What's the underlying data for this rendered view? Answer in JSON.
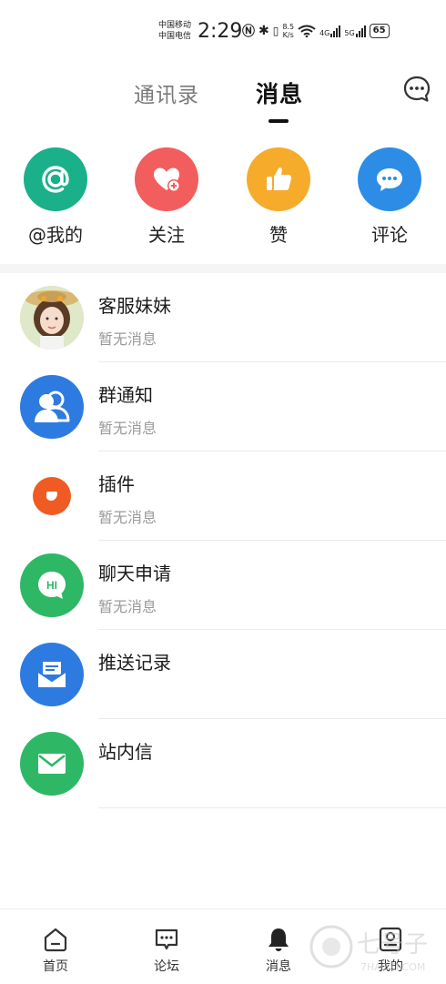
{
  "status_bar": {
    "carrier_1": "中国移动",
    "carrier_2": "中国电信",
    "time": "2:29",
    "net_speed_value": "8.5",
    "net_speed_unit": "K/s",
    "signal_1_label": "4G",
    "signal_2_label": "5G",
    "battery": "65"
  },
  "tabs": {
    "contacts": "通讯录",
    "messages": "消息",
    "active": "messages",
    "settings_icon": "chat-settings-icon"
  },
  "quick_actions": [
    {
      "label": "@我的",
      "icon": "at-icon",
      "color": "#1ab08a"
    },
    {
      "label": "关注",
      "icon": "heart-plus-icon",
      "color": "#f25d5d"
    },
    {
      "label": "赞",
      "icon": "thumbs-up-icon",
      "color": "#f6ab2a"
    },
    {
      "label": "评论",
      "icon": "comment-bubble-icon",
      "color": "#2d8ce6"
    }
  ],
  "messages": [
    {
      "name": "客服妹妹",
      "subtitle": "暂无消息",
      "icon": "customer-service-avatar"
    },
    {
      "name": "群通知",
      "subtitle": "暂无消息",
      "icon": "group-icon",
      "color": "#2d7be0"
    },
    {
      "name": "插件",
      "subtitle": "暂无消息",
      "icon": "plugin-icon",
      "color": "#ef5b22"
    },
    {
      "name": "聊天申请",
      "subtitle": "暂无消息",
      "icon": "hi-chat-icon",
      "color": "#2eb866"
    },
    {
      "name": "推送记录",
      "subtitle": "",
      "icon": "push-inbox-icon",
      "color": "#2d7be0"
    },
    {
      "name": "站内信",
      "subtitle": "",
      "icon": "mail-icon",
      "color": "#2eb866"
    }
  ],
  "bottom_nav": [
    {
      "label": "首页",
      "icon": "home-icon"
    },
    {
      "label": "论坛",
      "icon": "forum-icon"
    },
    {
      "label": "消息",
      "icon": "bell-icon",
      "active": true
    },
    {
      "label": "我的",
      "icon": "profile-icon"
    }
  ],
  "watermark": {
    "text": "七号子",
    "sub": "7HAOZI.COM"
  }
}
